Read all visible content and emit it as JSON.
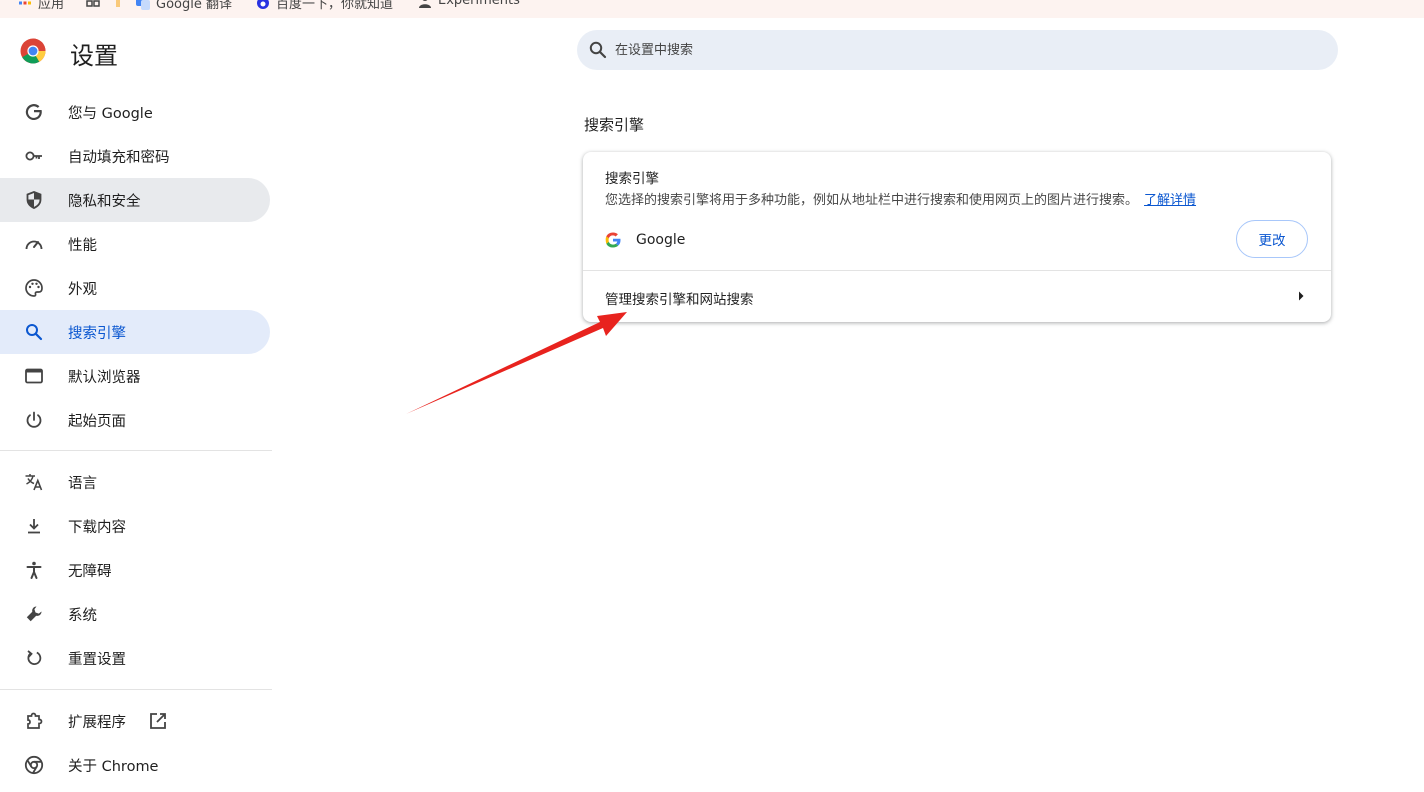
{
  "bookmarks": [
    {
      "label": "应用",
      "icon": "apps-grid-icon"
    },
    {
      "label": "",
      "icon": "grid-icon"
    },
    {
      "label": "Google 翻译",
      "icon": "translate-icon"
    },
    {
      "label": "百度一下，你就知道",
      "icon": "baidu-icon"
    },
    {
      "label": "Experiments",
      "icon": "person-icon"
    }
  ],
  "header": {
    "title": "设置",
    "search_placeholder": "在设置中搜索"
  },
  "sidebar": {
    "items": [
      {
        "label": "您与 Google",
        "icon": "google-g-icon"
      },
      {
        "label": "自动填充和密码",
        "icon": "key-icon"
      },
      {
        "label": "隐私和安全",
        "icon": "shield-icon"
      },
      {
        "label": "性能",
        "icon": "speedometer-icon"
      },
      {
        "label": "外观",
        "icon": "palette-icon"
      },
      {
        "label": "搜索引擎",
        "icon": "search-icon"
      },
      {
        "label": "默认浏览器",
        "icon": "browser-window-icon"
      },
      {
        "label": "起始页面",
        "icon": "power-icon"
      },
      {
        "label": "语言",
        "icon": "translate-icon"
      },
      {
        "label": "下载内容",
        "icon": "download-icon"
      },
      {
        "label": "无障碍",
        "icon": "accessibility-icon"
      },
      {
        "label": "系统",
        "icon": "wrench-icon"
      },
      {
        "label": "重置设置",
        "icon": "reset-icon"
      },
      {
        "label": "扩展程序",
        "icon": "puzzle-icon"
      },
      {
        "label": "关于 Chrome",
        "icon": "chrome-icon"
      }
    ],
    "active": "搜索引擎"
  },
  "main": {
    "section_title": "搜索引擎",
    "card": {
      "title": "搜索引擎",
      "description": "您选择的搜索引擎将用于多种功能，例如从地址栏中进行搜索和使用网页上的图片进行搜索。",
      "learn_more": "了解详情",
      "engine_name": "Google",
      "change_label": "更改",
      "manage_label": "管理搜索引擎和网站搜索"
    }
  },
  "colors": {
    "accent": "#0b57d0",
    "active_bg": "#e3ebfa",
    "search_bg": "#e9eef6",
    "annotation_arrow": "#e8231e"
  }
}
